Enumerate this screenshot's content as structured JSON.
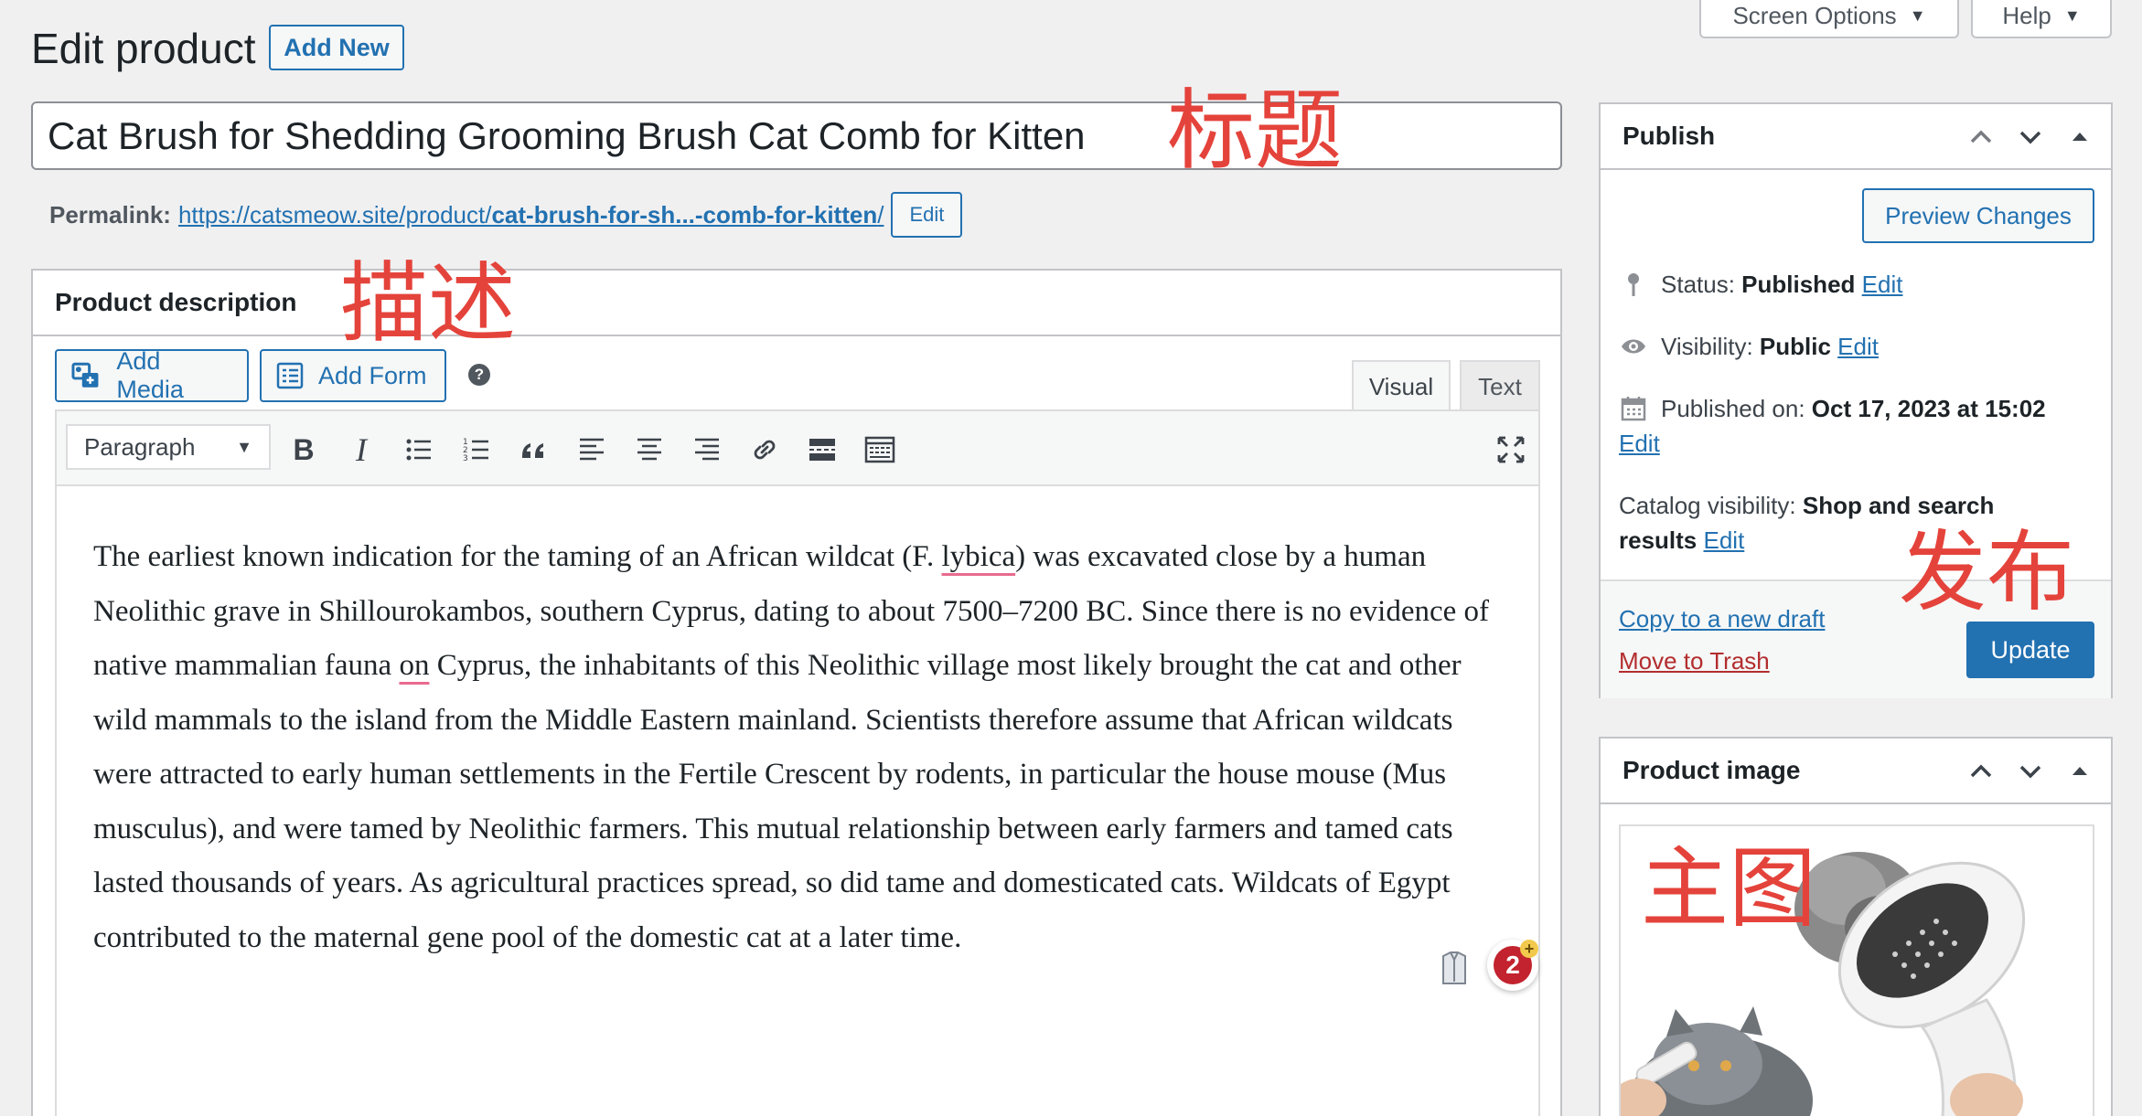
{
  "header": {
    "title": "Edit product",
    "add_new": "Add New",
    "screen_options": "Screen Options",
    "help": "Help"
  },
  "product": {
    "title": "Cat Brush for Shedding Grooming Brush Cat Comb for Kitten",
    "permalink_label": "Permalink:",
    "permalink_base": "https://catsmeow.site/product/",
    "permalink_slug": "cat-brush-for-sh...-comb-for-kitten",
    "permalink_trailing": "/",
    "permalink_edit": "Edit"
  },
  "annotations": {
    "title": "标题",
    "description": "描述",
    "publish": "发布",
    "main_image": "主图"
  },
  "description_panel": {
    "heading": "Product description",
    "add_media": "Add Media",
    "add_form": "Add Form",
    "help_icon": "?",
    "tab_visual": "Visual",
    "tab_text": "Text",
    "format_select": "Paragraph",
    "toolbar_icons": [
      "bold-icon",
      "italic-icon",
      "bulleted-list-icon",
      "numbered-list-icon",
      "blockquote-icon",
      "align-left-icon",
      "align-center-icon",
      "align-right-icon",
      "link-icon",
      "read-more-icon",
      "toolbar-toggle-icon",
      "fullscreen-icon"
    ],
    "body_before_lybica": "The earliest known indication for the taming of an African wildcat (F. ",
    "body_lybica": "lybica",
    "body_after_lybica": ") was excavated close by a human Neolithic grave in Shillourokambos, southern Cyprus, dating to about 7500–7200 BC. Since there is no evidence of native mammalian fauna ",
    "body_on": "on",
    "body_rest": " Cyprus, the inhabitants of this Neolithic village most likely brought the cat and other wild mammals to the island from the Middle Eastern mainland. Scientists therefore assume that African wildcats were attracted to early human settlements in the Fertile Crescent by rodents, in particular the house mouse (Mus musculus), and were tamed by Neolithic farmers. This mutual relationship between early farmers and tamed cats lasted thousands of years. As agricultural practices spread, so did tame and domesticated cats. Wildcats of Egypt contributed to the maternal gene pool of the domestic cat at a later time.",
    "grammar_badge_count": "2",
    "grammar_badge_plus": "+"
  },
  "publish_box": {
    "heading": "Publish",
    "preview_changes": "Preview Changes",
    "status_label": "Status:",
    "status_value": "Published",
    "visibility_label": "Visibility:",
    "visibility_value": "Public",
    "published_on_label": "Published on:",
    "published_on_value": "Oct 17, 2023 at 15:02",
    "catalog_label": "Catalog visibility:",
    "catalog_value_1": "Shop and search",
    "catalog_value_2": "results",
    "edit": "Edit",
    "copy_draft": "Copy to a new draft",
    "move_trash": "Move to Trash",
    "update": "Update"
  },
  "image_box": {
    "heading": "Product image"
  },
  "colors": {
    "accent": "#2271b1",
    "annotation": "#e4433b",
    "trash": "#b32d2e",
    "background": "#f0f0f1"
  }
}
